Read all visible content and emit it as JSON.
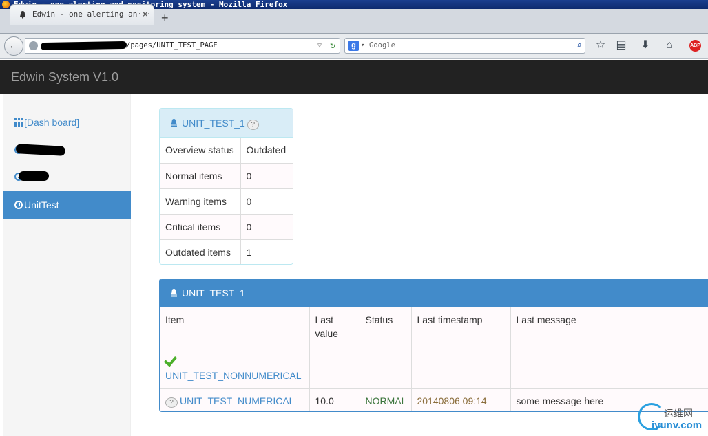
{
  "browser": {
    "window_title": "Edwin - one alerting and monitoring system - Mozilla Firefox",
    "tab_title": "Edwin - one alerting an···",
    "url_text": "/pages/UNIT_TEST_PAGE",
    "search_placeholder": "Google",
    "new_tab_glyph": "+",
    "close_tab_glyph": "×"
  },
  "app": {
    "title": "Edwin System V1.0"
  },
  "sidebar": {
    "items": [
      {
        "label": "[Dash board]",
        "icon": "grid-icon"
      },
      {
        "label": "",
        "icon": "clock-icon"
      },
      {
        "label": "",
        "icon": "clock-icon"
      },
      {
        "label": "UnitTest",
        "icon": "clock-icon",
        "active": true
      }
    ]
  },
  "summary": {
    "title": "UNIT_TEST_1",
    "help_glyph": "?",
    "rows": [
      {
        "key": "Overview status",
        "value": "Outdated"
      },
      {
        "key": "Normal items",
        "value": "0"
      },
      {
        "key": "Warning items",
        "value": "0"
      },
      {
        "key": "Critical items",
        "value": "0"
      },
      {
        "key": "Outdated items",
        "value": "1"
      }
    ]
  },
  "detail": {
    "title": "UNIT_TEST_1",
    "columns": [
      "Item",
      "Last value",
      "Status",
      "Last timestamp",
      "Last message"
    ],
    "rows": [
      {
        "item": "UNIT_TEST_NONNUMERICAL",
        "status_icon": "check-icon",
        "value": "",
        "status": "",
        "timestamp": "",
        "message": ""
      },
      {
        "item": "UNIT_TEST_NUMERICAL",
        "status_icon": "question-icon",
        "value": "10.0",
        "status": "NORMAL",
        "timestamp": "20140806 09:14",
        "message": "some message here"
      }
    ]
  },
  "watermark": {
    "cn": "运维网",
    "en": "iyunv.com"
  },
  "colors": {
    "primary": "#428bca",
    "header_bg": "#222222",
    "status_normal": "#3c763d",
    "timestamp": "#8a6d3b"
  }
}
